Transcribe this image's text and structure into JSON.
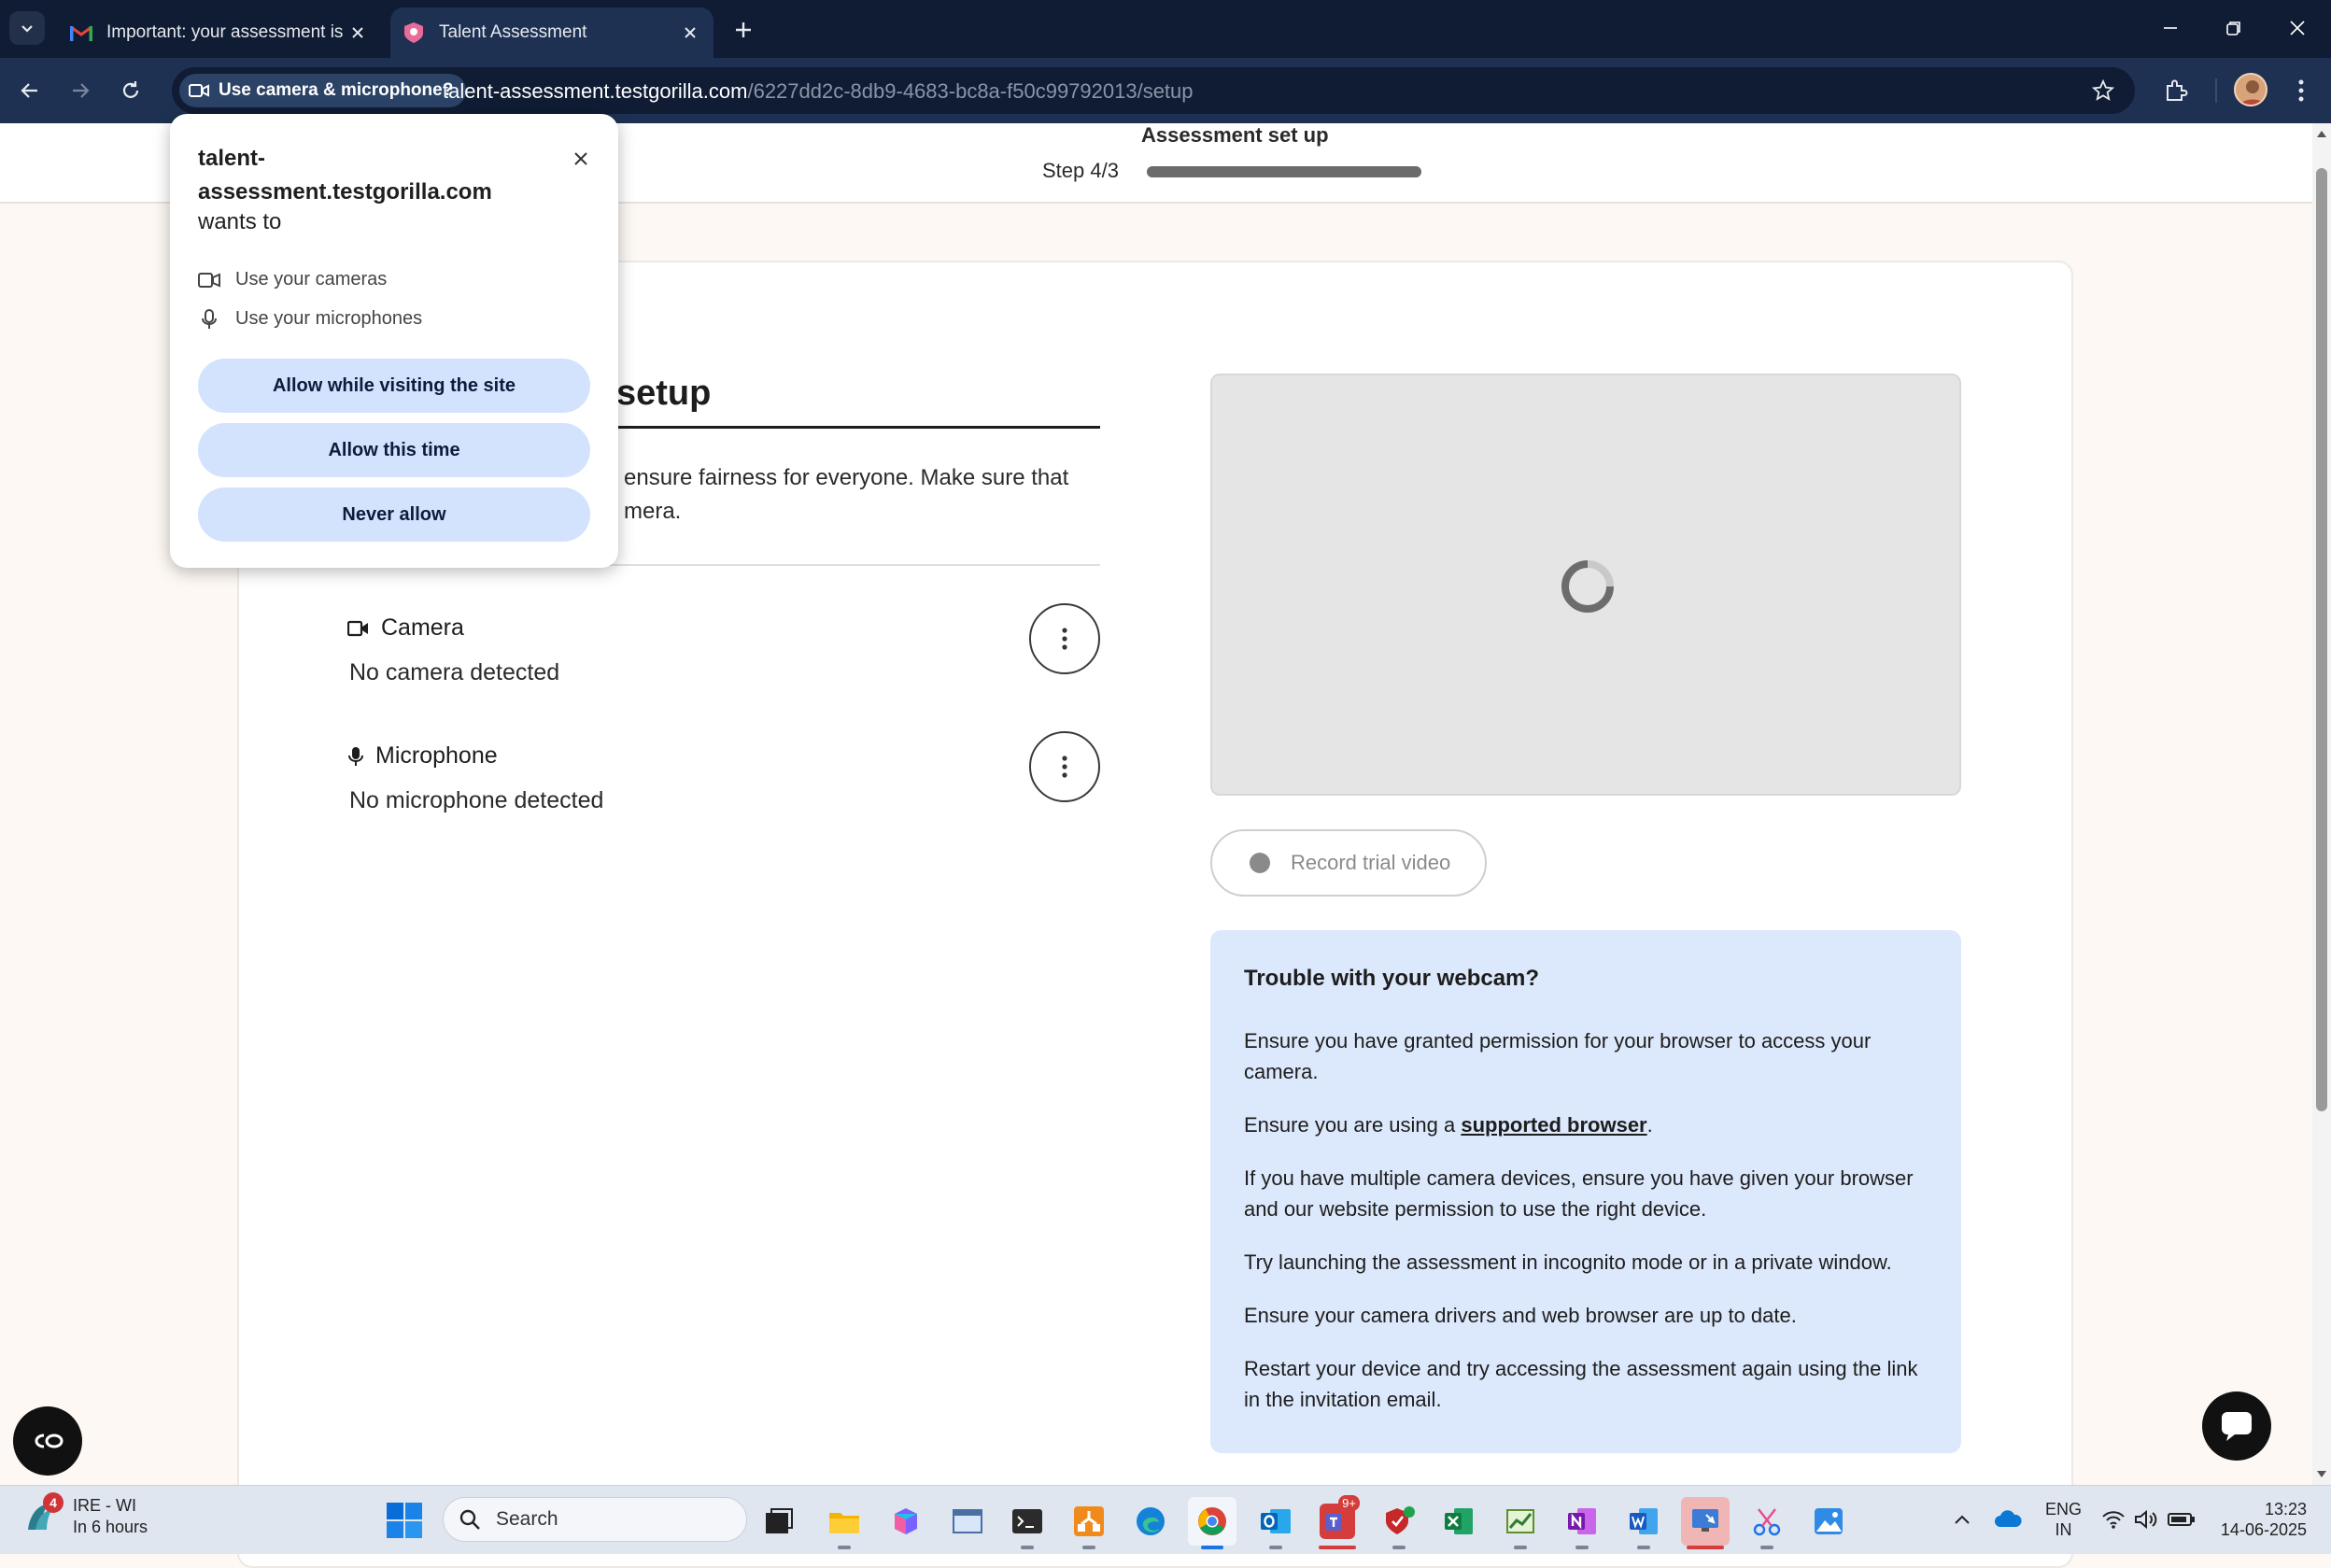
{
  "browser": {
    "tabs": [
      {
        "title": "Important: your assessment is w",
        "active": false
      },
      {
        "title": "Talent Assessment",
        "active": true
      }
    ],
    "permission_chip": "Use camera & microphone?",
    "url_host": "talent-assessment.testgorilla.com",
    "url_path": "/6227dd2c-8db9-4683-bc8a-f50c99792013/setup"
  },
  "header": {
    "title": "Assessment set up",
    "step": "Step 4/3",
    "progress": 1.0
  },
  "setup": {
    "title": "setup",
    "intro": "ensure fairness for everyone. Make sure that mera.",
    "devices": [
      {
        "name": "Camera",
        "status": "No camera detected",
        "icon": "camera-icon"
      },
      {
        "name": "Microphone",
        "status": "No microphone detected",
        "icon": "microphone-icon"
      }
    ],
    "record_label": "Record trial video"
  },
  "help": {
    "title": "Trouble with your webcam?",
    "p1": "Ensure you have granted permission for your browser to access your camera.",
    "p2_pre": "Ensure you are using a ",
    "p2_link": "supported browser",
    "p2_post": ".",
    "p3": "If you have multiple camera devices, ensure you have given your browser and our website permission to use the right device.",
    "p4": "Try launching the assessment in incognito mode or in a private window.",
    "p5": "Ensure your camera drivers and web browser are up to date.",
    "p6": "Restart your device and try accessing the assessment again using the link in the invitation email."
  },
  "popup": {
    "origin": "talent-assessment.testgorilla.com",
    "wants": "wants to",
    "perm_cameras": "Use your cameras",
    "perm_microphones": "Use your microphones",
    "btn_allow_visit": "Allow while visiting the site",
    "btn_allow_once": "Allow this time",
    "btn_never": "Never allow"
  },
  "taskbar": {
    "weather_badge": "4",
    "weather_title": "IRE - WI",
    "weather_sub": "In 6 hours",
    "search_placeholder": "Search",
    "lang_top": "ENG",
    "lang_bottom": "IN",
    "time": "13:23",
    "date": "14-06-2025",
    "teams_badge": "9+"
  },
  "colors": {
    "chrome_dark": "#0f1c33",
    "chrome_toolbar": "#1e3152",
    "popup_button": "#d3e3fd",
    "help_bg": "#dce8fb",
    "page_bg": "#fdf8f3"
  }
}
